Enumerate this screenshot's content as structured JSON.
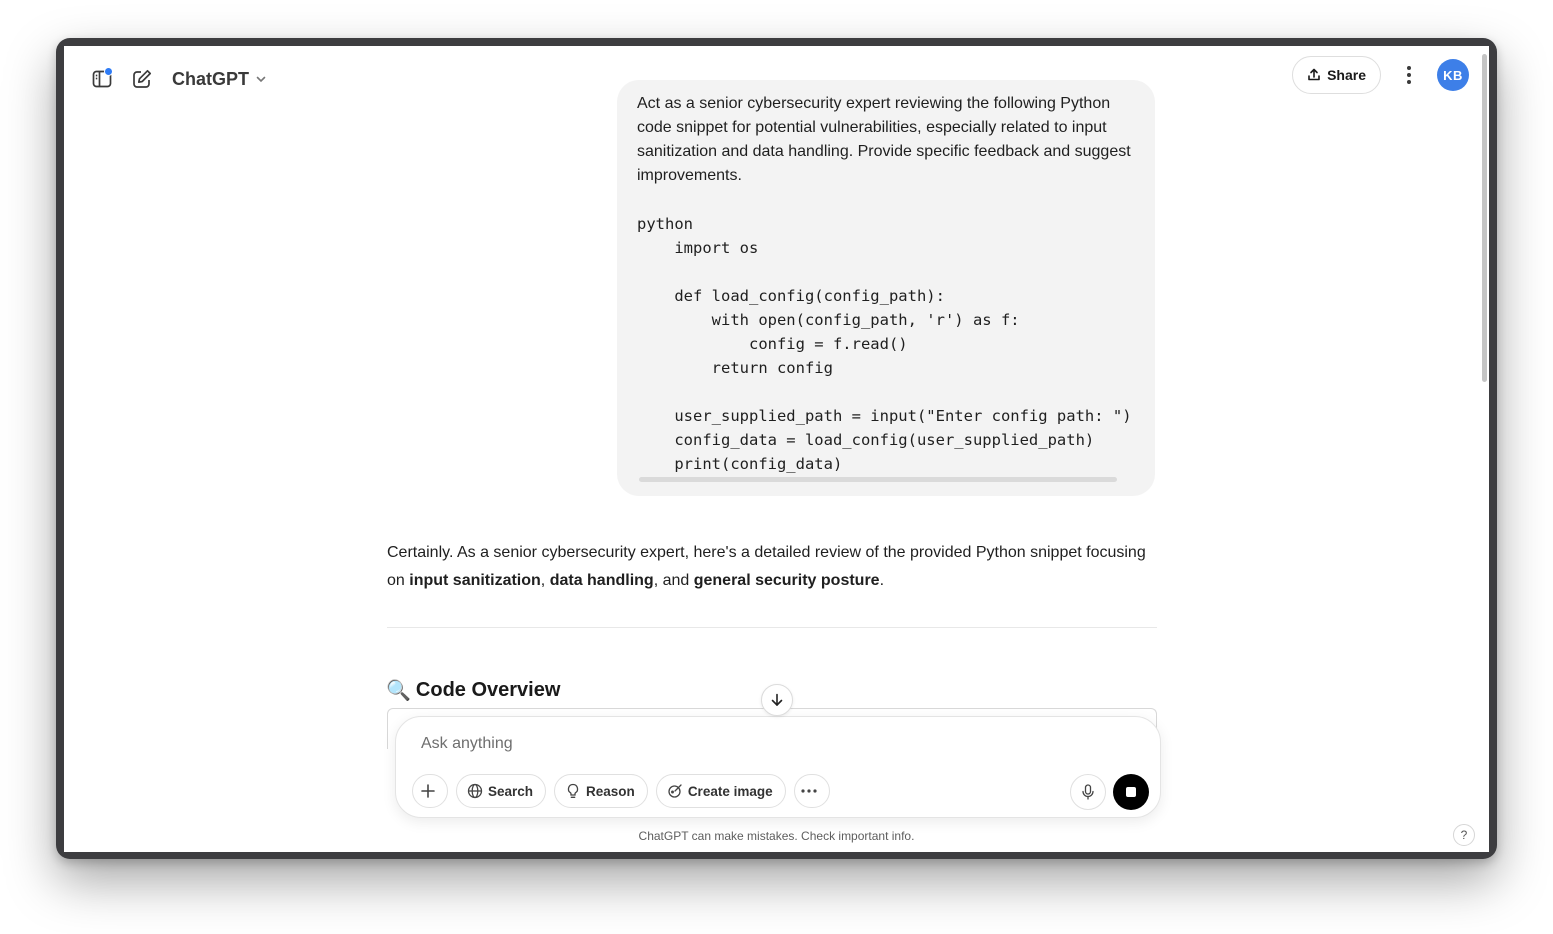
{
  "header": {
    "model_name": "ChatGPT",
    "share_label": "Share",
    "avatar_initials": "KB",
    "accent_color": "#3d7fe8"
  },
  "conversation": {
    "user_message": {
      "text": "Act as a senior cybersecurity expert reviewing the following Python code snippet for potential vulnerabilities, especially related to input sanitization and data handling. Provide specific feedback and suggest improvements.",
      "code": "python\n    import os\n\n    def load_config(config_path):\n        with open(config_path, 'r') as f:\n            config = f.read()\n        return config\n\n    user_supplied_path = input(\"Enter config path: \")\n    config_data = load_config(user_supplied_path)\n    print(config_data)"
    },
    "assistant_message": {
      "intro_1": "Certainly. As a senior cybersecurity expert, here's a detailed review of the provided Python snippet focusing on ",
      "bold_1": "input sanitization",
      "sep_1": ", ",
      "bold_2": "data handling",
      "sep_2": ", and ",
      "bold_3": "general security posture",
      "end": ".",
      "section_heading_emoji": "🔍",
      "section_heading": "Code Overview"
    }
  },
  "composer": {
    "placeholder": "Ask anything",
    "tools": {
      "search": "Search",
      "reason": "Reason",
      "create_image": "Create image"
    }
  },
  "footer": {
    "disclaimer": "ChatGPT can make mistakes. Check important info.",
    "help": "?"
  }
}
